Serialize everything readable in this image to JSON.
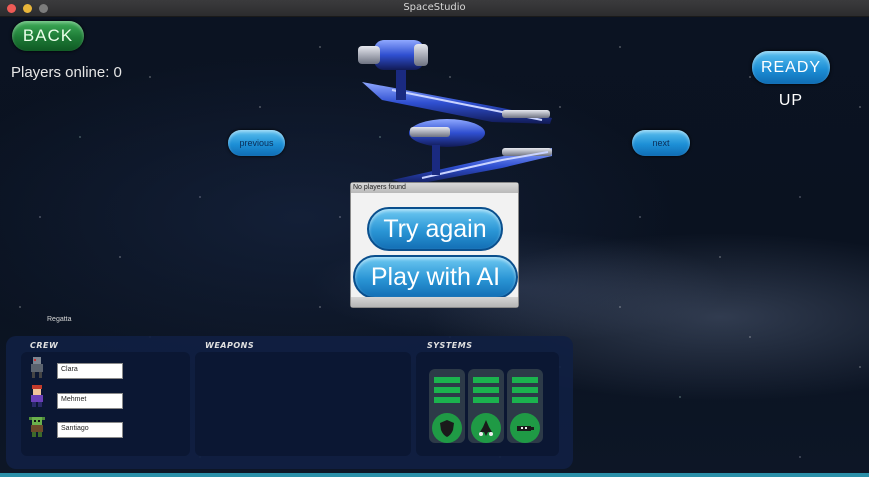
{
  "window": {
    "title": "SpaceStudio"
  },
  "top": {
    "back_label": "BACK",
    "players_online": "Players online: 0",
    "ready_label": "READY UP",
    "previous_label": "previous",
    "next_label": "next"
  },
  "dialog": {
    "title": "No players found",
    "try_again": "Try again",
    "play_ai": "Play with AI"
  },
  "ship_name": "Regatta",
  "panel": {
    "crew_header": "CREW",
    "weapons_header": "WEAPONS",
    "systems_header": "SYSTEMS",
    "crew": [
      {
        "name": "Clara",
        "icon": "robot-crew-icon"
      },
      {
        "name": "Mehmet",
        "icon": "human-crew-icon"
      },
      {
        "name": "Santiago",
        "icon": "alien-crew-icon"
      }
    ],
    "systems": [
      {
        "icon": "shield-icon",
        "bars": 3
      },
      {
        "icon": "engine-icon",
        "bars": 3
      },
      {
        "icon": "weapons-system-icon",
        "bars": 3
      }
    ]
  },
  "colors": {
    "back_button": "#1d7a36",
    "blue_button": "#1d8fd6",
    "system_green": "#1bb34e",
    "panel_bg": "#102042"
  }
}
